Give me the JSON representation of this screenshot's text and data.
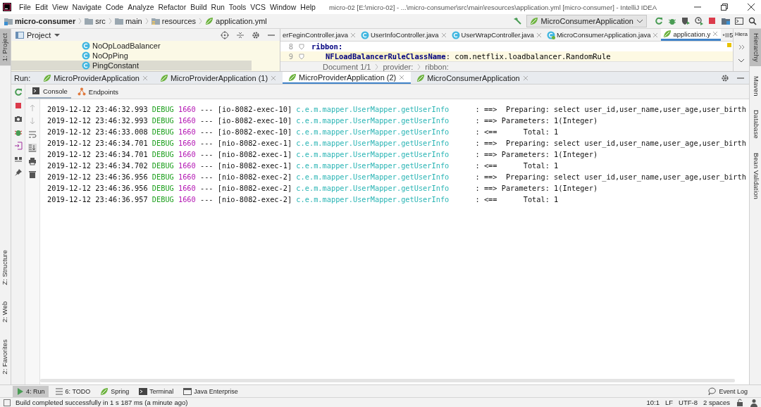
{
  "menu": [
    "File",
    "Edit",
    "View",
    "Navigate",
    "Code",
    "Analyze",
    "Refactor",
    "Build",
    "Run",
    "Tools",
    "VCS",
    "Window",
    "Help"
  ],
  "window_title": "micro-02 [E:\\micro-02] - ...\\micro-consumer\\src\\main\\resources\\application.yml [micro-consumer] - IntelliJ IDEA",
  "breadcrumbs": [
    {
      "label": "micro-consumer",
      "kind": "module"
    },
    {
      "label": "src",
      "kind": "folder"
    },
    {
      "label": "main",
      "kind": "folder"
    },
    {
      "label": "resources",
      "kind": "resources"
    },
    {
      "label": "application.yml",
      "kind": "yml"
    }
  ],
  "run_configuration": "MicroConsumerApplication",
  "project_panel": {
    "title": "Project",
    "items": [
      {
        "label": "NoOpLoadBalancer",
        "selected": false
      },
      {
        "label": "NoOpPing",
        "selected": false
      },
      {
        "label": "PingConstant",
        "selected": true
      }
    ]
  },
  "editor": {
    "tabs": [
      {
        "label": "erFeginController.java",
        "selected": false
      },
      {
        "label": "UserInfoController.java",
        "kind": "java",
        "selected": false
      },
      {
        "label": "UserWrapController.java",
        "kind": "java",
        "selected": false
      },
      {
        "label": "MicroConsumerApplication.java",
        "kind": "app",
        "selected": false
      },
      {
        "label": "application.y",
        "kind": "yml",
        "selected": true
      }
    ],
    "overflow_count": "5",
    "lines": [
      {
        "number": "8",
        "key": "ribbon:"
      },
      {
        "number": "9",
        "key": "NFLoadBalancerRuleClassName",
        "value": ": com.netflix.loadbalancer.RandomRule"
      }
    ],
    "breadcrumbs": [
      "Document 1/1",
      "provider:",
      "ribbon:"
    ]
  },
  "hierarchy_title": "Hiera",
  "run": {
    "label": "Run:",
    "tabs": [
      {
        "label": "MicroProviderApplication",
        "selected": false
      },
      {
        "label": "MicroProviderApplication (1)",
        "selected": false
      },
      {
        "label": "MicroProviderApplication (2)",
        "selected": true
      },
      {
        "label": "MicroConsumerApplication",
        "selected": false
      }
    ],
    "subtabs": [
      {
        "label": "Console",
        "kind": "console",
        "selected": true
      },
      {
        "label": "Endpoints",
        "kind": "endpoints",
        "selected": false
      }
    ],
    "console": [
      {
        "timestamp": "2019-12-12 23:46:32.993",
        "level": "DEBUG",
        "pid": "1660",
        "sep": "---",
        "thread": "[io-8082-exec-10]",
        "logger": "c.e.m.mapper.UserMapper.getUserInfo",
        "message": ": ==>  Preparing: select user_id,user_name,user_age,user_birth"
      },
      {
        "timestamp": "2019-12-12 23:46:32.993",
        "level": "DEBUG",
        "pid": "1660",
        "sep": "---",
        "thread": "[io-8082-exec-10]",
        "logger": "c.e.m.mapper.UserMapper.getUserInfo",
        "message": ": ==> Parameters: 1(Integer)"
      },
      {
        "timestamp": "2019-12-12 23:46:33.008",
        "level": "DEBUG",
        "pid": "1660",
        "sep": "---",
        "thread": "[io-8082-exec-10]",
        "logger": "c.e.m.mapper.UserMapper.getUserInfo",
        "message": ": <==      Total: 1"
      },
      {
        "timestamp": "2019-12-12 23:46:34.701",
        "level": "DEBUG",
        "pid": "1660",
        "sep": "---",
        "thread": "[nio-8082-exec-1]",
        "logger": "c.e.m.mapper.UserMapper.getUserInfo",
        "message": ": ==>  Preparing: select user_id,user_name,user_age,user_birth"
      },
      {
        "timestamp": "2019-12-12 23:46:34.701",
        "level": "DEBUG",
        "pid": "1660",
        "sep": "---",
        "thread": "[nio-8082-exec-1]",
        "logger": "c.e.m.mapper.UserMapper.getUserInfo",
        "message": ": ==> Parameters: 1(Integer)"
      },
      {
        "timestamp": "2019-12-12 23:46:34.702",
        "level": "DEBUG",
        "pid": "1660",
        "sep": "---",
        "thread": "[nio-8082-exec-1]",
        "logger": "c.e.m.mapper.UserMapper.getUserInfo",
        "message": ": <==      Total: 1"
      },
      {
        "timestamp": "2019-12-12 23:46:36.956",
        "level": "DEBUG",
        "pid": "1660",
        "sep": "---",
        "thread": "[nio-8082-exec-2]",
        "logger": "c.e.m.mapper.UserMapper.getUserInfo",
        "message": ": ==>  Preparing: select user_id,user_name,user_age,user_birth"
      },
      {
        "timestamp": "2019-12-12 23:46:36.956",
        "level": "DEBUG",
        "pid": "1660",
        "sep": "---",
        "thread": "[nio-8082-exec-2]",
        "logger": "c.e.m.mapper.UserMapper.getUserInfo",
        "message": ": ==> Parameters: 1(Integer)"
      },
      {
        "timestamp": "2019-12-12 23:46:36.957",
        "level": "DEBUG",
        "pid": "1660",
        "sep": "---",
        "thread": "[nio-8082-exec-2]",
        "logger": "c.e.m.mapper.UserMapper.getUserInfo",
        "message": ": <==      Total: 1"
      }
    ]
  },
  "left_stripe": {
    "top": [
      {
        "label": "1: Project",
        "selected": true
      }
    ],
    "bottom": [
      {
        "label": "Z: Structure",
        "selected": false
      },
      {
        "label": "2: Web",
        "selected": false
      },
      {
        "label": "2: Favorites",
        "selected": false
      }
    ]
  },
  "right_stripe": [
    {
      "label": "Hierarchy",
      "selected": true
    },
    {
      "label": "Maven",
      "selected": false
    },
    {
      "label": "Database",
      "selected": false
    },
    {
      "label": "Bean Validation",
      "selected": false
    }
  ],
  "bottom_tools": [
    {
      "label": "4: Run",
      "kind": "run",
      "selected": true
    },
    {
      "label": "6: TODO",
      "kind": "todo",
      "selected": false
    },
    {
      "label": "Spring",
      "kind": "spring",
      "selected": false
    },
    {
      "label": "Terminal",
      "kind": "terminal",
      "selected": false
    },
    {
      "label": "Java Enterprise",
      "kind": "enterprise",
      "selected": false
    }
  ],
  "event_log": "Event Log",
  "status": {
    "message": "Build completed successfully in 1 s 187 ms (a minute ago)",
    "items": [
      "10:1",
      "LF",
      "UTF-8",
      "2 spaces"
    ]
  }
}
